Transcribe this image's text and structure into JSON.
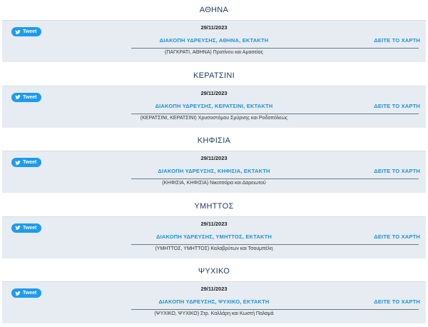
{
  "regions": [
    {
      "title": "ΑΘΗΝΑ",
      "tweet_label": "Tweet",
      "date": "29/11/2023",
      "headline": "ΔΙΑΚΟΠΗ ΥΔΡΕΥΣΗΣ, ΑΘΗΝΑ, ΕΚΤΑΚΤΗ",
      "map_link": "ΔΕΙΤΕ ΤΟ ΧΑΡΤΗ",
      "address": "(ΠΑΓΚΡΑΤΙ, ΑΘΗΝΑ) Πρατίνου και Αμασείας"
    },
    {
      "title": "ΚΕΡΑΤΣΙΝΙ",
      "tweet_label": "Tweet",
      "date": "29/11/2023",
      "headline": "ΔΙΑΚΟΠΗ ΥΔΡΕΥΣΗΣ, ΚΕΡΑΤΣΙΝΙ, ΕΚΤΑΚΤΗ",
      "map_link": "ΔΕΙΤΕ ΤΟ ΧΑΡΤΗ",
      "address": "(ΚΕΡΑΤΣΙΝΙ, ΚΕΡΑΤΣΙΝΙ) Χρυσοστόμου Σμύρνης και Ροδοπόλεως"
    },
    {
      "title": "ΚΗΦΙΣΙΑ",
      "tweet_label": "Tweet",
      "date": "29/11/2023",
      "headline": "ΔΙΑΚΟΠΗ ΥΔΡΕΥΣΗΣ, ΚΗΦΙΣΙΑ, ΕΚΤΑΚΤΗ",
      "map_link": "ΔΕΙΤΕ ΤΟ ΧΑΡΤΗ",
      "address": "(ΚΗΦΙΣΙΑ, ΚΗΦΙΣΙΑ) Νικοτσάρα και Δαρειωτού"
    },
    {
      "title": "ΥΜΗΤΤΟΣ",
      "tweet_label": "Tweet",
      "date": "29/11/2023",
      "headline": "ΔΙΑΚΟΠΗ ΥΔΡΕΥΣΗΣ, ΥΜΗΤΤΟΣ, ΕΚΤΑΚΤΗ",
      "map_link": "ΔΕΙΤΕ ΤΟ ΧΑΡΤΗ",
      "address": "(ΥΜΗΤΤΟΣ, ΥΜΗΤΤΟΣ) Καλαβρύτων και Τσουμπέλη"
    },
    {
      "title": "ΨΥΧΙΚΟ",
      "tweet_label": "Tweet",
      "date": "29/11/2023",
      "headline": "ΔΙΑΚΟΠΗ ΥΔΡΕΥΣΗΣ, ΨΥΧΙΚΟ, ΕΚΤΑΚΤΗ",
      "map_link": "ΔΕΙΤΕ ΤΟ ΧΑΡΤΗ",
      "address": "(ΨΥΧΙΚΟ, ΨΥΧΙΚΟ) Στρ. Καλλάρη και Κωστή Παλαμά"
    }
  ],
  "icons": {
    "tweet_button": "twitter-bird-icon"
  },
  "colors": {
    "tweet_button": "#1d9bf0",
    "link": "#1e90d6",
    "title": "#1e3a5f",
    "card_background": "#e6ecf1"
  }
}
